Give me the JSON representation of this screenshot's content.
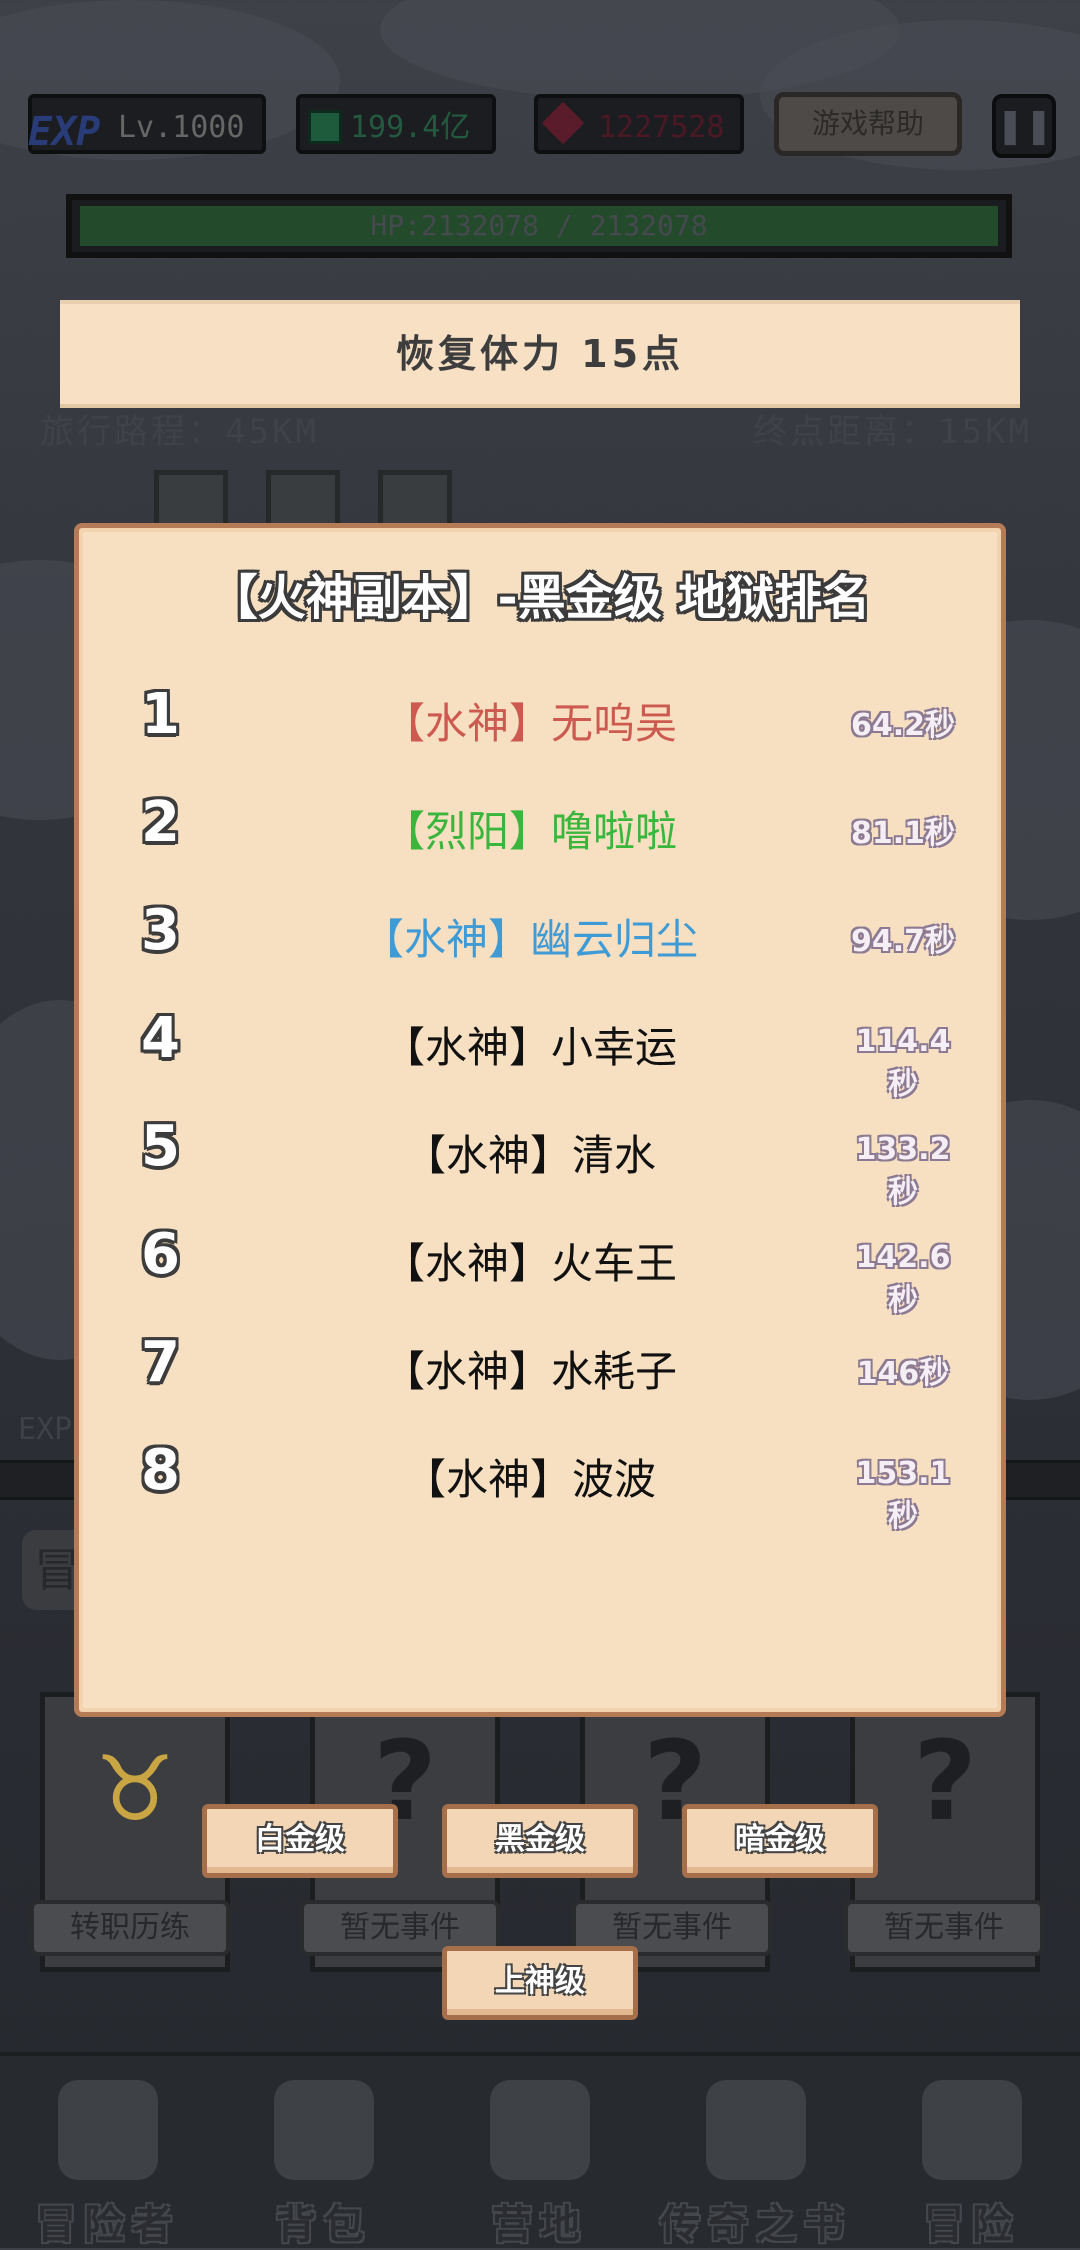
{
  "hud": {
    "exp_tag": "EXP",
    "level": "Lv.1000",
    "gems": "199.4亿",
    "rubies": "1227528",
    "help_label": "游戏帮助",
    "pause_icon": "pause-icon"
  },
  "hp": {
    "text": "HP:2132078 / 2132078",
    "fill_percent": 100
  },
  "toast": "恢复体力 15点",
  "journey": {
    "traveled": "旅行路程：45KM",
    "remaining": "终点距离：15KM"
  },
  "dialog": {
    "title": "【火神副本】-黑金级 地狱排名",
    "rankings": [
      {
        "rank": "1",
        "name": "【水神】无呜吴",
        "time": "64.2秒",
        "color": "#cd5a50"
      },
      {
        "rank": "2",
        "name": "【烈阳】噜啦啦",
        "time": "81.1秒",
        "color": "#3ab63d"
      },
      {
        "rank": "3",
        "name": "【水神】幽云归尘",
        "time": "94.7秒",
        "color": "#3f9bd6"
      },
      {
        "rank": "4",
        "name": "【水神】小幸运",
        "time": "114.4秒",
        "color": "#111111"
      },
      {
        "rank": "5",
        "name": "【水神】清水",
        "time": "133.2秒",
        "color": "#111111"
      },
      {
        "rank": "6",
        "name": "【水神】火车王",
        "time": "142.6秒",
        "color": "#111111"
      },
      {
        "rank": "7",
        "name": "【水神】水耗子",
        "time": "146秒",
        "color": "#111111"
      },
      {
        "rank": "8",
        "name": "【水神】波波",
        "time": "153.1秒",
        "color": "#111111"
      }
    ]
  },
  "tiers": {
    "platinum": "白金级",
    "black_gold": "黑金级",
    "dark_gold": "暗金级",
    "upper_god": "上神级"
  },
  "events": {
    "job_change": "转职历练",
    "none1": "暂无事件",
    "none2": "暂无事件",
    "none3": "暂无事件"
  },
  "exp_bar_label": "EXP",
  "adventure_tab": "冒",
  "nav": [
    {
      "label": "冒险者",
      "icon": "helmet-icon"
    },
    {
      "label": "背包",
      "icon": "bag-icon"
    },
    {
      "label": "营地",
      "icon": "camp-icon"
    },
    {
      "label": "传奇之书",
      "icon": "book-icon"
    },
    {
      "label": "冒险",
      "icon": "sword-icon"
    }
  ]
}
